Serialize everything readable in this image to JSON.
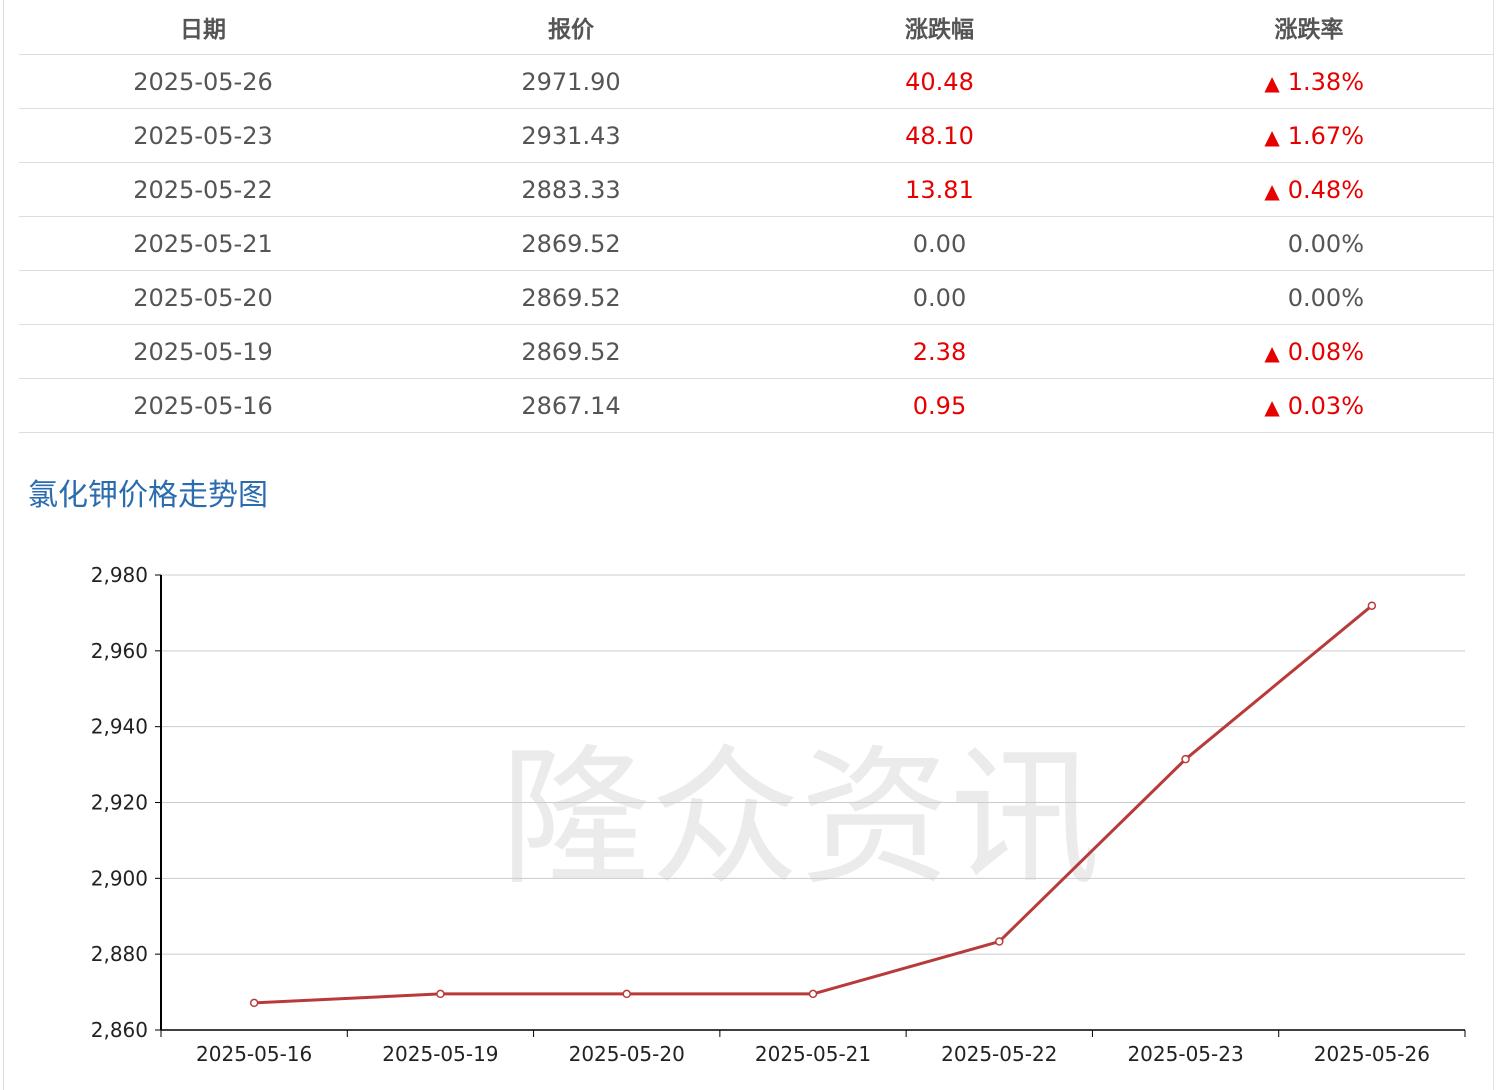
{
  "table": {
    "headers": [
      "日期",
      "报价",
      "涨跌幅",
      "涨跌率"
    ],
    "rows": [
      {
        "date": "2025-05-26",
        "price": "2971.90",
        "change": "40.48",
        "rate": "1.38%",
        "dir": "up"
      },
      {
        "date": "2025-05-23",
        "price": "2931.43",
        "change": "48.10",
        "rate": "1.67%",
        "dir": "up"
      },
      {
        "date": "2025-05-22",
        "price": "2883.33",
        "change": "13.81",
        "rate": "0.48%",
        "dir": "up"
      },
      {
        "date": "2025-05-21",
        "price": "2869.52",
        "change": "0.00",
        "rate": "0.00%",
        "dir": "flat"
      },
      {
        "date": "2025-05-20",
        "price": "2869.52",
        "change": "0.00",
        "rate": "0.00%",
        "dir": "flat"
      },
      {
        "date": "2025-05-19",
        "price": "2869.52",
        "change": "2.38",
        "rate": "0.08%",
        "dir": "up"
      },
      {
        "date": "2025-05-16",
        "price": "2867.14",
        "change": "0.95",
        "rate": "0.03%",
        "dir": "up"
      }
    ],
    "up_arrow": "▲"
  },
  "chart_title": "氯化钾价格走势图",
  "watermark": "隆众资讯",
  "colors": {
    "up": "#e60000",
    "line": "#b93a3a",
    "title": "#2b6cb0",
    "grid": "#cccccc",
    "text": "#555555"
  },
  "chart_data": {
    "type": "line",
    "categories": [
      "2025-05-16",
      "2025-05-19",
      "2025-05-20",
      "2025-05-21",
      "2025-05-22",
      "2025-05-23",
      "2025-05-26"
    ],
    "series": [
      {
        "values": [
          2867.14,
          2869.52,
          2869.52,
          2869.52,
          2883.33,
          2931.43,
          2971.9
        ]
      }
    ],
    "yticks": [
      "2,860",
      "2,880",
      "2,900",
      "2,920",
      "2,940",
      "2,960",
      "2,980"
    ],
    "ylim": [
      2860,
      2980
    ],
    "grid": true,
    "legend": "none"
  }
}
